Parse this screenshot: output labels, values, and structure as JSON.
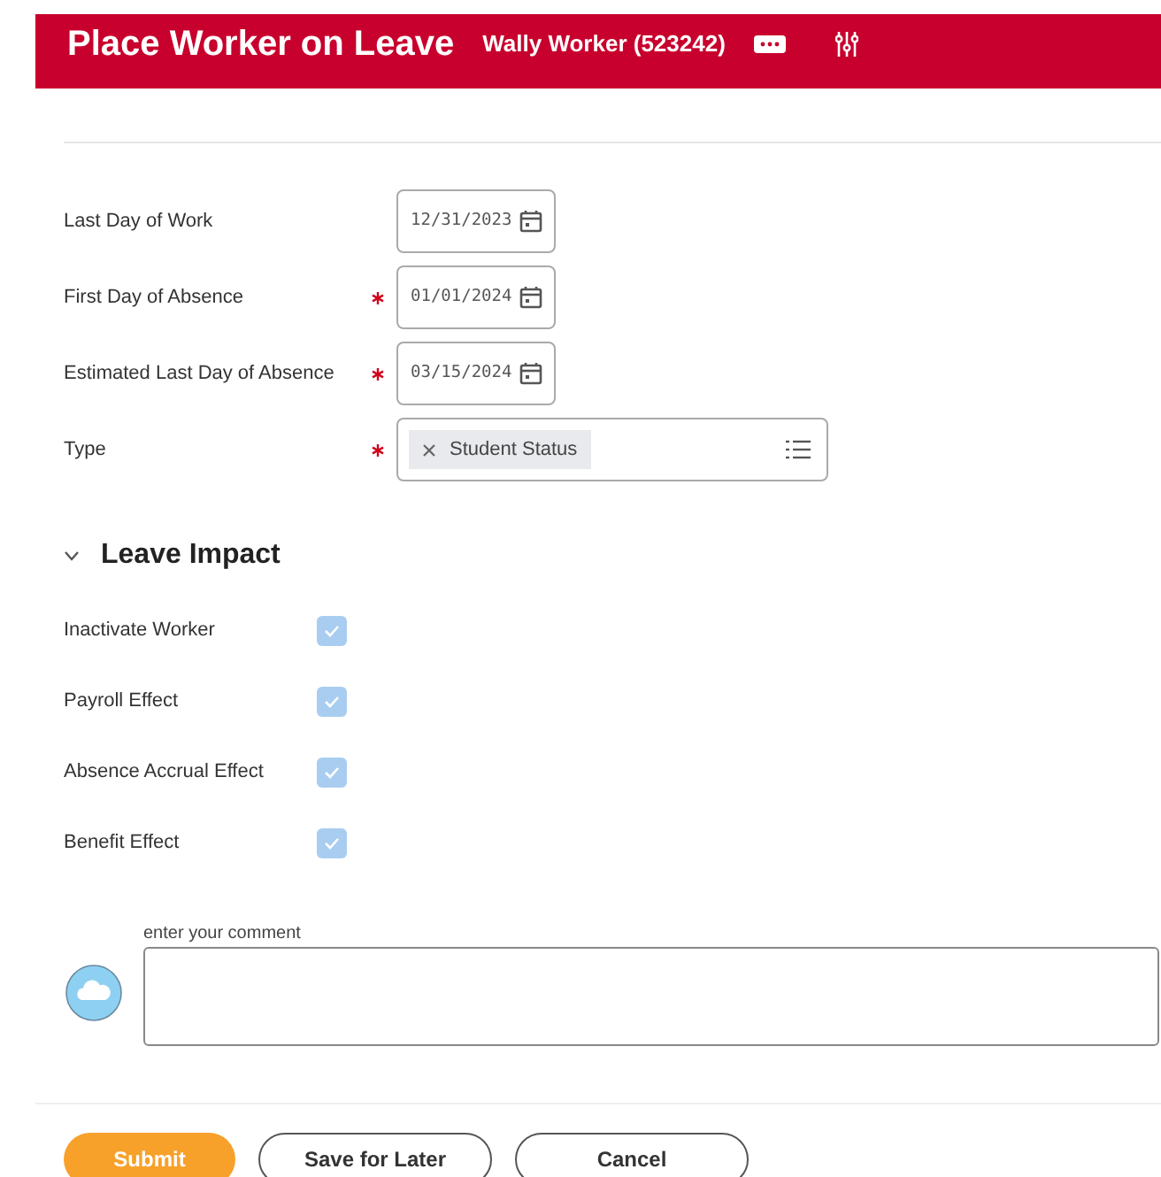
{
  "header": {
    "title": "Place Worker on Leave",
    "worker": "Wally Worker (523242)"
  },
  "fields": [
    {
      "kind": "date",
      "label": "Last Day of Work",
      "required": false,
      "value": "12/31/2023"
    },
    {
      "kind": "date",
      "label": "First Day of Absence",
      "required": true,
      "value": "01/01/2024"
    },
    {
      "kind": "date",
      "label": "Estimated Last Day of Absence",
      "required": true,
      "value": "03/15/2024"
    },
    {
      "kind": "multiselect",
      "label": "Type",
      "required": true,
      "value": "Student Status"
    }
  ],
  "section": {
    "title": "Leave Impact",
    "expanded": true,
    "items": [
      {
        "label": "Inactivate Worker",
        "checked": true
      },
      {
        "label": "Payroll Effect",
        "checked": true
      },
      {
        "label": "Absence Accrual Effect",
        "checked": true
      },
      {
        "label": "Benefit Effect",
        "checked": true
      }
    ]
  },
  "comment": {
    "label": "enter your comment"
  },
  "buttons": [
    {
      "label": "Submit",
      "kind": "primary"
    },
    {
      "label": "Save for Later",
      "kind": "secondary"
    },
    {
      "label": "Cancel",
      "kind": "secondary"
    }
  ]
}
